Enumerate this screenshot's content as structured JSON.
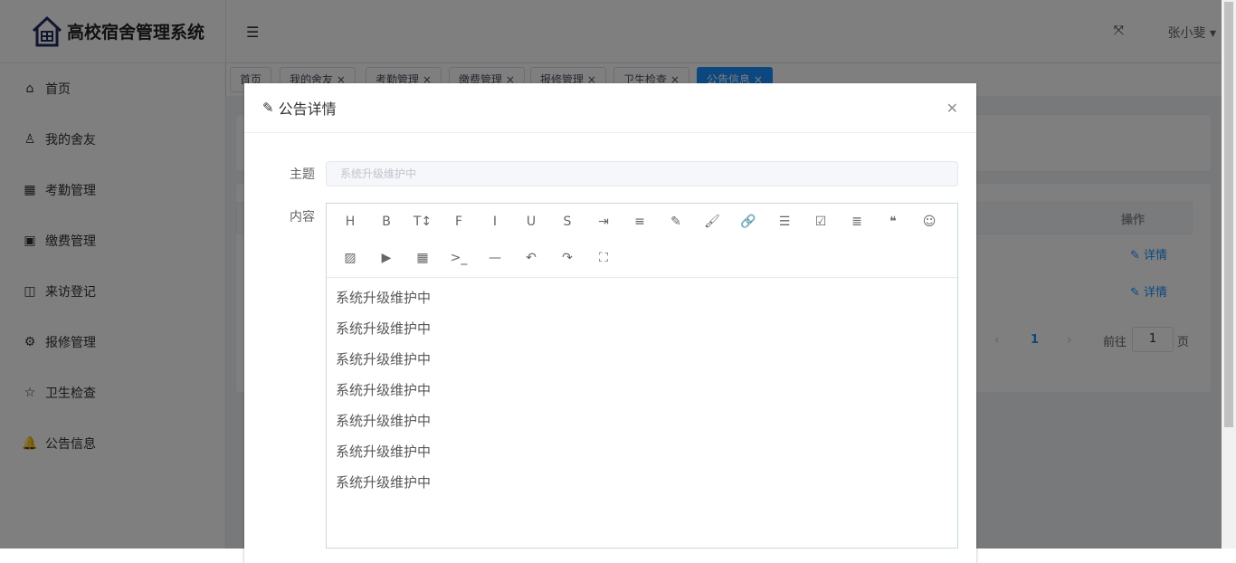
{
  "app": {
    "title": "高校宿舍管理系统",
    "user": "张小斐"
  },
  "sidebar": {
    "items": [
      {
        "label": "首页",
        "icon": "home-icon",
        "glyph": "⌂"
      },
      {
        "label": "我的舍友",
        "icon": "user-icon",
        "glyph": "♙"
      },
      {
        "label": "考勤管理",
        "icon": "calendar-icon",
        "glyph": "▦"
      },
      {
        "label": "缴费管理",
        "icon": "wallet-icon",
        "glyph": "▣"
      },
      {
        "label": "来访登记",
        "icon": "door-icon",
        "glyph": "◫"
      },
      {
        "label": "报修管理",
        "icon": "gear-icon",
        "glyph": "⚙"
      },
      {
        "label": "卫生检查",
        "icon": "star-icon",
        "glyph": "☆"
      },
      {
        "label": "公告信息",
        "icon": "bell-icon",
        "glyph": "🔔"
      }
    ]
  },
  "tabs": [
    "首页",
    "我的舍友",
    "考勤管理",
    "缴费管理",
    "报修管理",
    "卫生检查",
    "公告信息"
  ],
  "table": {
    "op_header": "操作",
    "row_action": "详情"
  },
  "pagination": {
    "current": "1",
    "goto_label": "前往",
    "goto_value": "1",
    "page_suffix": "页"
  },
  "dialog": {
    "title": "公告详情",
    "subject_label": "主题",
    "subject_value": "系统升级维护中",
    "content_label": "内容",
    "content_lines": [
      "系统升级维护中",
      "系统升级维护中",
      "系统升级维护中",
      "系统升级维护中",
      "系统升级维护中",
      "系统升级维护中",
      "系统升级维护中"
    ]
  },
  "toolbar": [
    {
      "n": "heading",
      "g": "H"
    },
    {
      "n": "bold",
      "g": "B"
    },
    {
      "n": "font-size",
      "g": "T↕"
    },
    {
      "n": "font-name",
      "g": "F"
    },
    {
      "n": "italic",
      "g": "I"
    },
    {
      "n": "underline",
      "g": "U"
    },
    {
      "n": "strikethrough",
      "g": "S"
    },
    {
      "n": "indent",
      "g": "⇥"
    },
    {
      "n": "line-height",
      "g": "≡"
    },
    {
      "n": "font-color",
      "g": "✎"
    },
    {
      "n": "background-color",
      "g": "🖌"
    },
    {
      "n": "link",
      "g": "🔗"
    },
    {
      "n": "list",
      "g": "☰"
    },
    {
      "n": "todo",
      "g": "☑"
    },
    {
      "n": "justify",
      "g": "≣"
    },
    {
      "n": "quote",
      "g": "❝"
    },
    {
      "n": "emoticon",
      "g": "☺"
    },
    {
      "n": "image",
      "g": "▨"
    },
    {
      "n": "video",
      "g": "▶"
    },
    {
      "n": "table",
      "g": "▦"
    },
    {
      "n": "code",
      "g": ">_"
    },
    {
      "n": "divider",
      "g": "—"
    },
    {
      "n": "undo",
      "g": "↶"
    },
    {
      "n": "redo",
      "g": "↷"
    },
    {
      "n": "fullscreen",
      "g": "⛶"
    }
  ]
}
